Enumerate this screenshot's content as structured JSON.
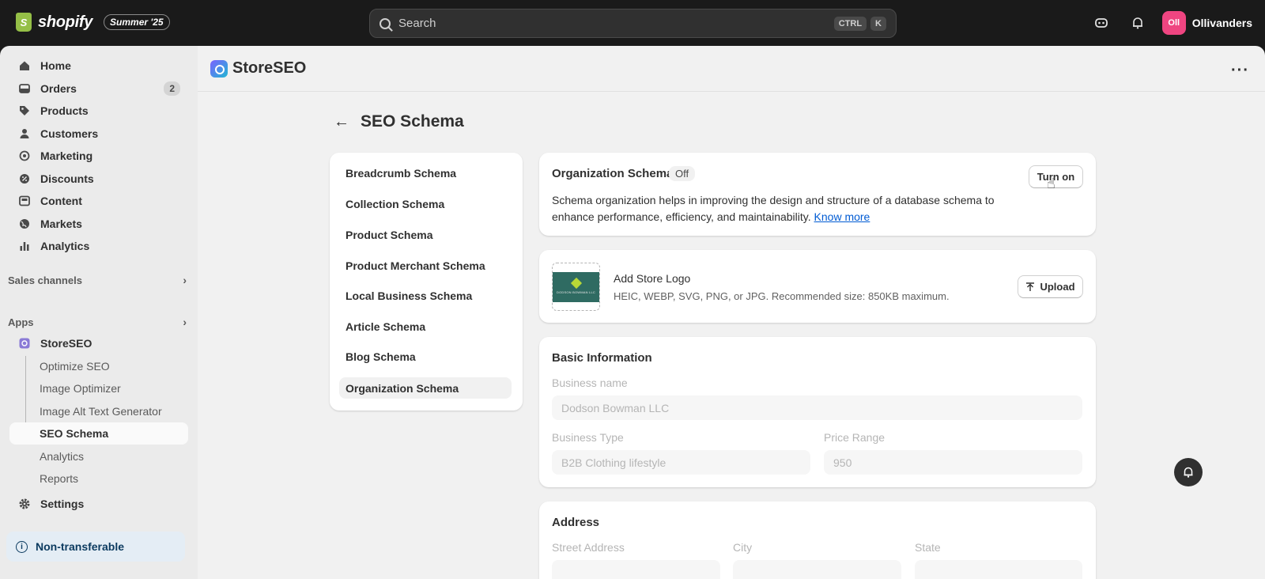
{
  "topbar": {
    "brand": "shopify",
    "edition": "Summer '25",
    "search_placeholder": "Search",
    "shortcut_keys": [
      "CTRL",
      "K"
    ],
    "store_initials": "Oll",
    "store_name": "Ollivanders"
  },
  "sidebar": {
    "items": [
      {
        "label": "Home",
        "icon": "home-icon"
      },
      {
        "label": "Orders",
        "icon": "orders-icon",
        "count": "2"
      },
      {
        "label": "Products",
        "icon": "tag-icon"
      },
      {
        "label": "Customers",
        "icon": "person-icon"
      },
      {
        "label": "Marketing",
        "icon": "target-icon"
      },
      {
        "label": "Discounts",
        "icon": "discount-icon"
      },
      {
        "label": "Content",
        "icon": "content-icon"
      },
      {
        "label": "Markets",
        "icon": "globe-icon"
      },
      {
        "label": "Analytics",
        "icon": "bar-chart-icon"
      }
    ],
    "sales_channels_label": "Sales channels",
    "apps_label": "Apps",
    "app_name": "StoreSEO",
    "app_subitems": [
      "Optimize SEO",
      "Image Optimizer",
      "Image Alt Text Generator",
      "SEO Schema",
      "Analytics",
      "Reports"
    ],
    "active_subitem": "SEO Schema",
    "settings_label": "Settings",
    "notice": "Non-transferable"
  },
  "app": {
    "title": "StoreSEO",
    "page_title": "SEO Schema"
  },
  "schema_list": [
    "Breadcrumb Schema",
    "Collection Schema",
    "Product Schema",
    "Product Merchant Schema",
    "Local Business Schema",
    "Article Schema",
    "Blog Schema",
    "Organization Schema"
  ],
  "org_card": {
    "title": "Organization Schema",
    "status": "Off",
    "button": "Turn on",
    "description": "Schema organization helps in improving the design and structure of a database schema to enhance performance, efficiency, and maintainability.",
    "link": "Know more"
  },
  "logo_card": {
    "logo_text": "DODSON BOWMAN LLC",
    "title": "Add Store Logo",
    "hint": "HEIC, WEBP, SVG, PNG, or JPG. Recommended size: 850KB maximum.",
    "button": "Upload"
  },
  "basic_card": {
    "title": "Basic Information",
    "business_name_label": "Business name",
    "business_name_value": "Dodson Bowman LLC",
    "business_type_label": "Business Type",
    "business_type_value": "B2B Clothing lifestyle",
    "price_range_label": "Price Range",
    "price_range_value": "950"
  },
  "address_card": {
    "title": "Address",
    "street_label": "Street Address",
    "city_label": "City",
    "state_label": "State"
  },
  "colors": {
    "accent_link": "#005bd3",
    "brand_green": "#95bf47",
    "store_avatar": "#ef4581"
  }
}
